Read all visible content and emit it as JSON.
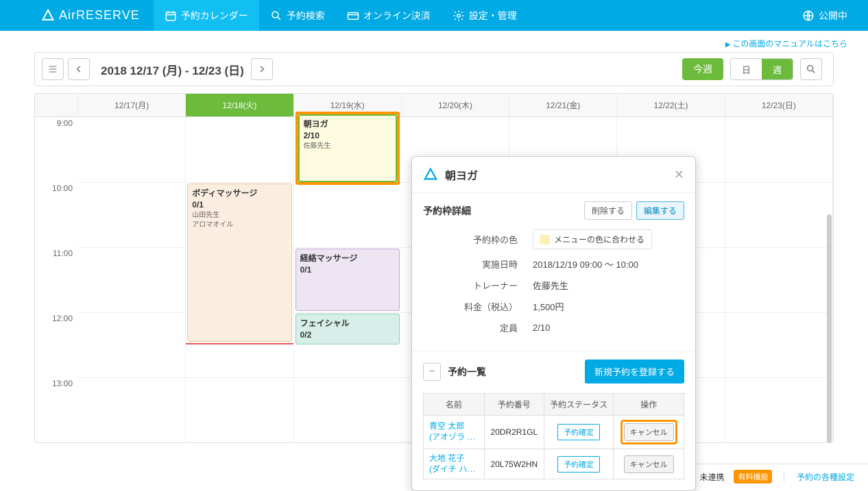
{
  "header": {
    "logo": "AirRESERVE",
    "nav": [
      {
        "label": "予約カレンダー",
        "active": true
      },
      {
        "label": "予約検索"
      },
      {
        "label": "オンライン決済"
      },
      {
        "label": "設定・管理"
      }
    ],
    "publish": "公開中"
  },
  "manual_link": "この画面のマニュアルはこちら",
  "toolbar": {
    "date_range": "2018 12/17 (月) - 12/23 (日)",
    "this_week": "今週",
    "view_day": "日",
    "view_week": "週"
  },
  "calendar": {
    "days": [
      "12/17(月)",
      "12/18(火)",
      "12/19(水)",
      "12/20(木)",
      "12/21(金)",
      "12/22(土)",
      "12/23(日)"
    ],
    "today_index": 1,
    "times": [
      "9:00",
      "10:00",
      "11:00",
      "12:00",
      "13:00"
    ]
  },
  "events": {
    "highlighted": {
      "title": "朝ヨガ",
      "count": "2/10",
      "trainer": "佐藤先生"
    },
    "body_massage": {
      "title": "ボディマッサージ",
      "count": "0/1",
      "trainer": "山田先生",
      "note": "アロマオイル"
    },
    "keiraku": {
      "title": "経絡マッサージ",
      "count": "0/1"
    },
    "facial": {
      "title": "フェイシャル",
      "count": "0/2"
    }
  },
  "popup": {
    "title": "朝ヨガ",
    "section1_title": "予約枠詳細",
    "btn_delete": "削除する",
    "btn_edit": "編集する",
    "labels": {
      "color": "予約枠の色",
      "datetime": "実施日時",
      "trainer": "トレーナー",
      "price": "料金（税込）",
      "capacity": "定員"
    },
    "values": {
      "color_text": "メニューの色に合わせる",
      "datetime": "2018/12/19 09:00 〜 10:00",
      "trainer": "佐藤先生",
      "price": "1,500円",
      "capacity": "2/10"
    },
    "section2_title": "予約一覧",
    "btn_new": "新規予約を登録する",
    "table": {
      "headers": [
        "名前",
        "予約番号",
        "予約ステータス",
        "操作"
      ],
      "rows": [
        {
          "name_line1": "青空 太郎",
          "name_line2": "(アオゾラ …",
          "number": "20DR2R1GL",
          "status": "予約確定",
          "action": "キャンセル"
        },
        {
          "name_line1": "大地 花子",
          "name_line2": "(ダイチ ハ…",
          "number": "20L75W2HN",
          "status": "予約確定",
          "action": "キャンセル"
        }
      ]
    }
  },
  "footer": {
    "unlinked": "未連携",
    "paid": "有料機能",
    "settings": "予約の各種設定"
  }
}
